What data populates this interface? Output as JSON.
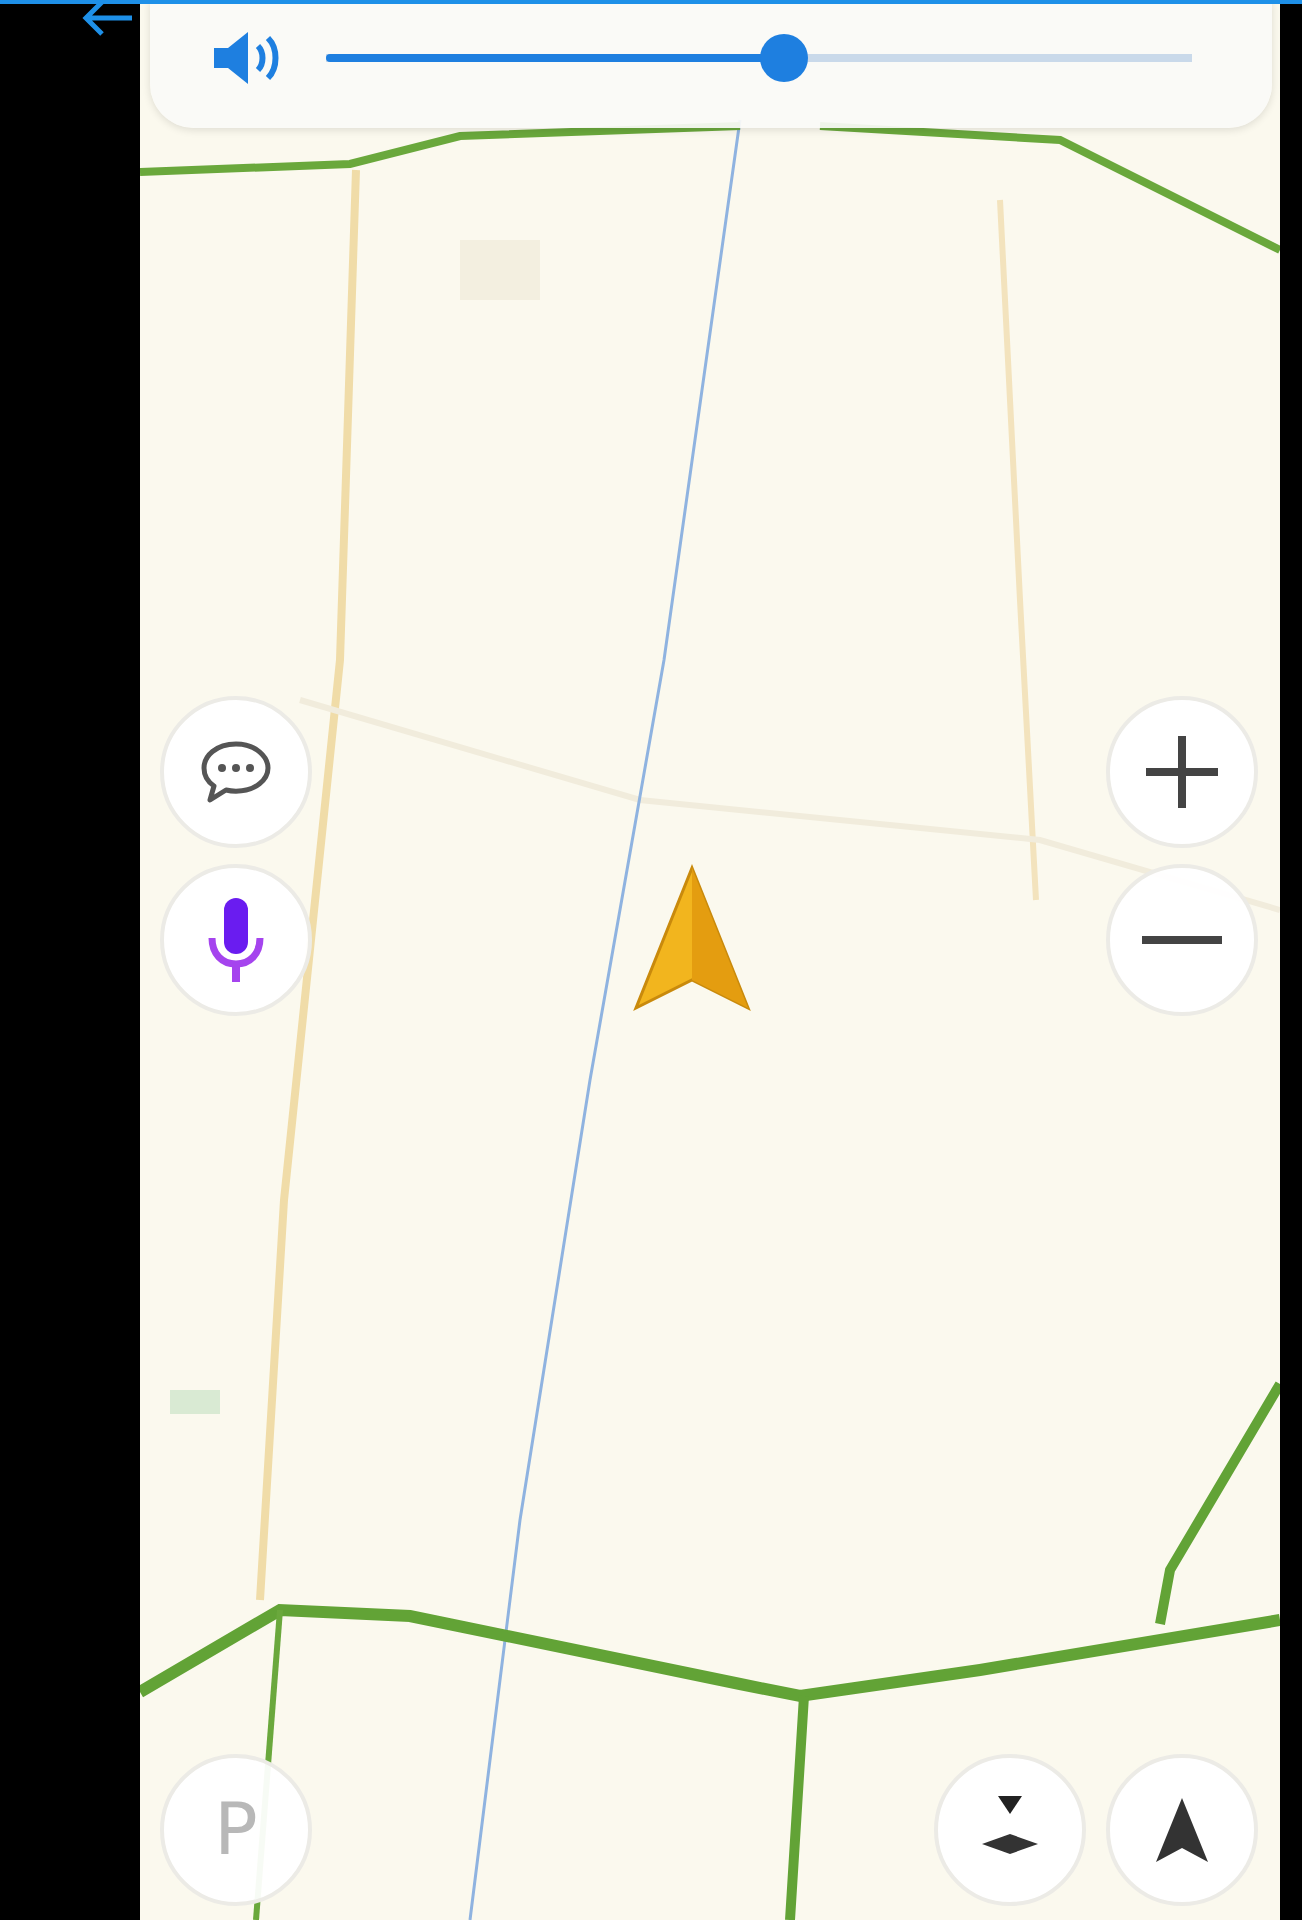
{
  "volume": {
    "level": 0.53
  },
  "left_controls": [
    {
      "kind": "chat"
    },
    {
      "kind": "microphone"
    }
  ],
  "zoom_controls": [
    {
      "kind": "zoom_in"
    },
    {
      "kind": "zoom_out"
    }
  ],
  "parking_button": {
    "label": "P"
  },
  "bottom_controls": [
    {
      "kind": "compass"
    },
    {
      "kind": "navigate"
    }
  ]
}
